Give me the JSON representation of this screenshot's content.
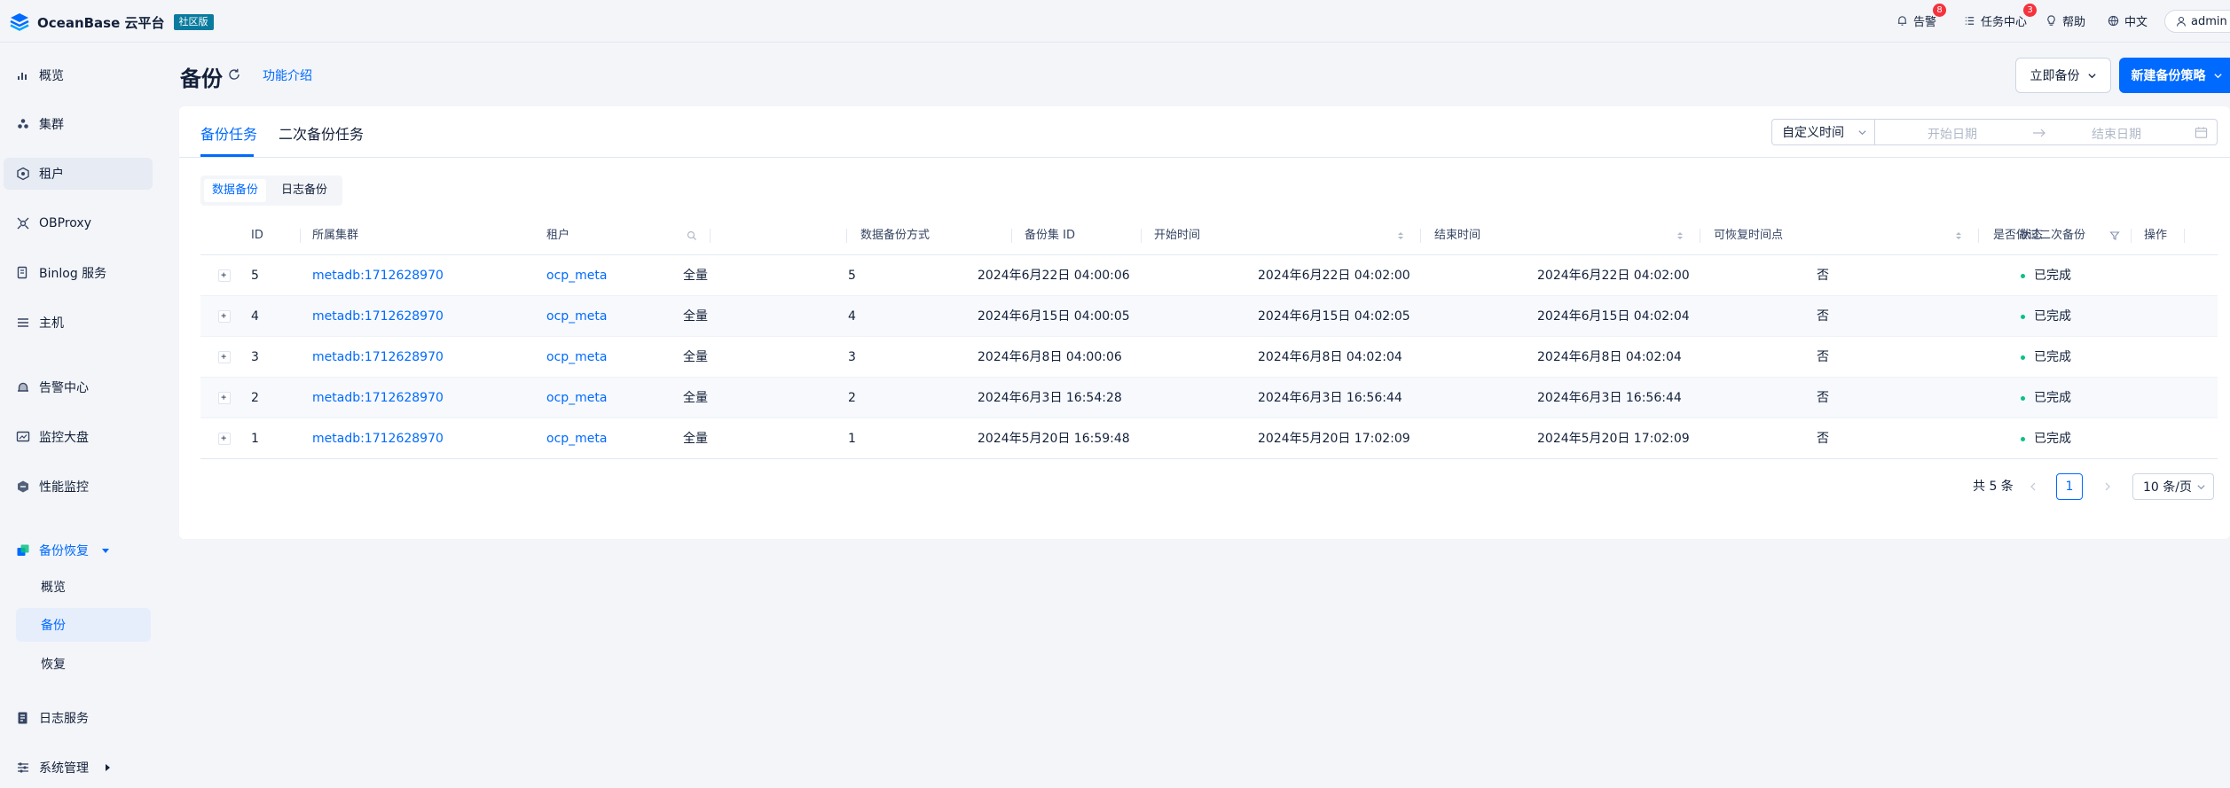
{
  "app": {
    "brand": "OceanBase 云平台",
    "edition": "社区版"
  },
  "topbar": {
    "alerts_label": "告警",
    "alerts_count": "8",
    "tasks_label": "任务中心",
    "tasks_count": "3",
    "help_label": "帮助",
    "language_label": "中文",
    "user_label": "admin"
  },
  "sidebar": {
    "items": [
      {
        "label": "概览",
        "icon": "bar-chart-icon"
      },
      {
        "label": "集群",
        "icon": "cluster-icon"
      },
      {
        "label": "租户",
        "icon": "tenant-icon"
      },
      {
        "label": "OBProxy",
        "icon": "proxy-icon"
      },
      {
        "label": "Binlog 服务",
        "icon": "binlog-icon"
      },
      {
        "label": "主机",
        "icon": "host-icon"
      },
      {
        "label": "告警中心",
        "icon": "alarm-icon"
      },
      {
        "label": "监控大盘",
        "icon": "dashboard-icon"
      },
      {
        "label": "性能监控",
        "icon": "performance-icon"
      },
      {
        "label": "备份恢复",
        "icon": "backup-icon"
      },
      {
        "label": "日志服务",
        "icon": "log-icon"
      },
      {
        "label": "系统管理",
        "icon": "settings-icon"
      }
    ],
    "backup_children": [
      {
        "label": "概览"
      },
      {
        "label": "备份"
      },
      {
        "label": "恢复"
      }
    ]
  },
  "header": {
    "title": "备份",
    "intro_link": "功能介绍",
    "backup_now_label": "立即备份",
    "new_policy_label": "新建备份策略"
  },
  "tabs": [
    {
      "label": "备份任务",
      "active": true
    },
    {
      "label": "二次备份任务",
      "active": false
    }
  ],
  "filters": {
    "time_mode": "自定义时间",
    "start_placeholder": "开始日期",
    "end_placeholder": "结束日期"
  },
  "segment": {
    "options": [
      "数据备份",
      "日志备份"
    ],
    "selected": "数据备份"
  },
  "table": {
    "columns": [
      "ID",
      "所属集群",
      "租户",
      "数据备份方式",
      "备份集 ID",
      "开始时间",
      "结束时间",
      "可恢复时间点",
      "是否做过二次备份",
      "状态",
      "操作"
    ],
    "rows": [
      {
        "id": "5",
        "cluster": "metadb:1712628970",
        "tenant": "ocp_meta",
        "mode": "全量",
        "set_id": "5",
        "start": "2024年6月22日 04:00:06",
        "end": "2024年6月22日 04:02:00",
        "recoverable": "2024年6月22日 04:02:00",
        "secondary": "否",
        "status": "已完成"
      },
      {
        "id": "4",
        "cluster": "metadb:1712628970",
        "tenant": "ocp_meta",
        "mode": "全量",
        "set_id": "4",
        "start": "2024年6月15日 04:00:05",
        "end": "2024年6月15日 04:02:05",
        "recoverable": "2024年6月15日 04:02:04",
        "secondary": "否",
        "status": "已完成"
      },
      {
        "id": "3",
        "cluster": "metadb:1712628970",
        "tenant": "ocp_meta",
        "mode": "全量",
        "set_id": "3",
        "start": "2024年6月8日 04:00:06",
        "end": "2024年6月8日 04:02:04",
        "recoverable": "2024年6月8日 04:02:04",
        "secondary": "否",
        "status": "已完成"
      },
      {
        "id": "2",
        "cluster": "metadb:1712628970",
        "tenant": "ocp_meta",
        "mode": "全量",
        "set_id": "2",
        "start": "2024年6月3日 16:54:28",
        "end": "2024年6月3日 16:56:44",
        "recoverable": "2024年6月3日 16:56:44",
        "secondary": "否",
        "status": "已完成"
      },
      {
        "id": "1",
        "cluster": "metadb:1712628970",
        "tenant": "ocp_meta",
        "mode": "全量",
        "set_id": "1",
        "start": "2024年5月20日 16:59:48",
        "end": "2024年5月20日 17:02:09",
        "recoverable": "2024年5月20日 17:02:09",
        "secondary": "否",
        "status": "已完成"
      }
    ]
  },
  "pagination": {
    "total_label": "共 5 条",
    "current_page": "1",
    "page_size_label": "10 条/页"
  },
  "colors": {
    "primary": "#006aff",
    "success": "#0ac185",
    "badge": "#f4333c",
    "edition_badge": "#0a7b9e"
  }
}
